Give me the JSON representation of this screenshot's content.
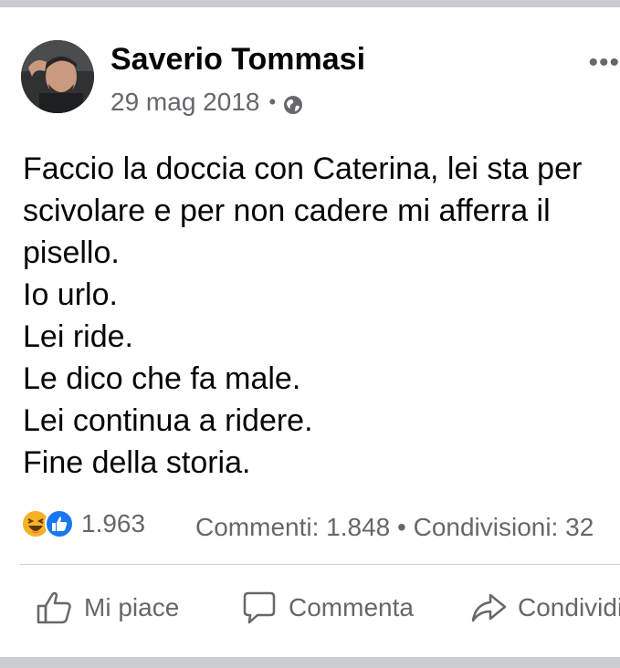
{
  "post": {
    "author": "Saverio Tommasi",
    "date": "29 mag 2018",
    "separator": "•",
    "privacy_icon": "globe-icon",
    "more_label": "•••",
    "lines": [
      "Faccio la doccia con Caterina, lei sta per",
      "scivolare e per non cadere mi afferra il",
      "pisello.",
      "Io urlo.",
      "Lei ride.",
      "Le dico che fa male.",
      "Lei continua a ridere.",
      "Fine della storia."
    ]
  },
  "engagement": {
    "reaction_icons": [
      "haha-icon",
      "like-icon"
    ],
    "reaction_count": "1.963",
    "comments_text": "Commenti: 1.848",
    "dot": "•",
    "shares_text": "Condivisioni: 32"
  },
  "actions": {
    "like_label": "Mi piace",
    "comment_label": "Commenta",
    "share_label": "Condividi"
  },
  "colors": {
    "text": "#050505",
    "secondary": "#65676b",
    "like_blue": "#1877f2",
    "haha_yellow": "#f7b125",
    "divider": "#ced0d4"
  }
}
